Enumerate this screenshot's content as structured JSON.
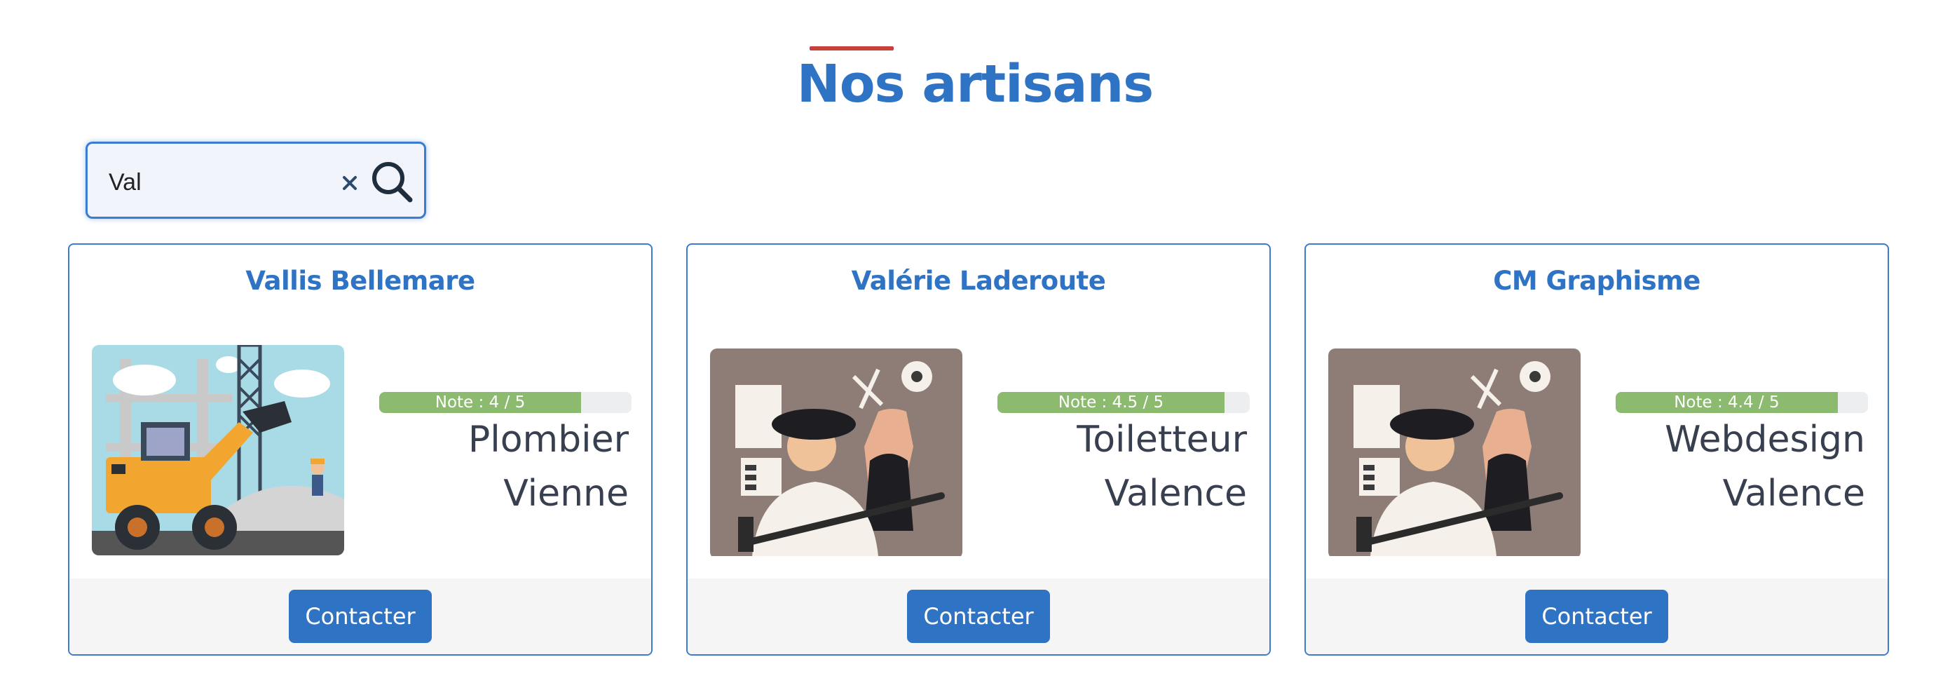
{
  "page": {
    "title": "Nos artisans"
  },
  "search": {
    "value": "Val",
    "clear_symbol": "×"
  },
  "colors": {
    "accent": "#2f73c4",
    "title_bar": "#c8423b",
    "rating_fill": "#8cbb6f"
  },
  "artisans": [
    {
      "name": "Vallis Bellemare",
      "rating_label": "Note : 4 / 5",
      "rating": 4,
      "rating_max": 5,
      "job": "Plombier",
      "city": "Vienne",
      "illustration": "construction-loader-illustration",
      "contact_label": "Contacter"
    },
    {
      "name": "Valérie Laderoute",
      "rating_label": "Note : 4.5 / 5",
      "rating": 4.5,
      "rating_max": 5,
      "job": "Toiletteur",
      "city": "Valence",
      "illustration": "tailor-illustration",
      "contact_label": "Contacter"
    },
    {
      "name": "CM Graphisme",
      "rating_label": "Note : 4.4 / 5",
      "rating": 4.4,
      "rating_max": 5,
      "job": "Webdesign",
      "city": "Valence",
      "illustration": "tailor-illustration",
      "contact_label": "Contacter"
    }
  ]
}
